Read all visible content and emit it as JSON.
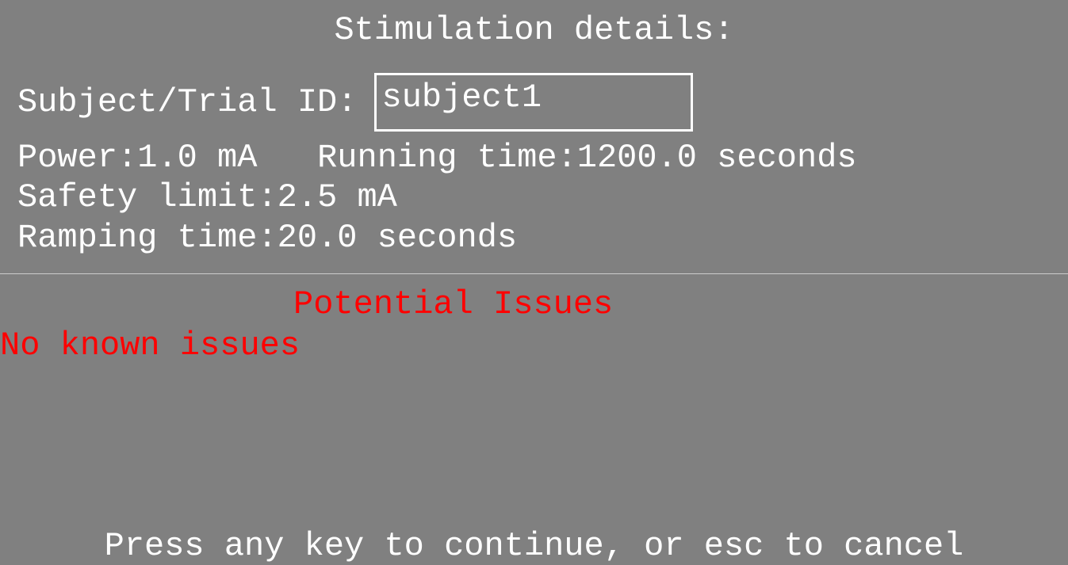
{
  "header": {
    "title": "Stimulation details:"
  },
  "subject": {
    "label": "Subject/Trial ID: ",
    "value": "subject1"
  },
  "params": {
    "power_label": "Power:",
    "power_value": "1.0 mA",
    "running_time_label": "Running time:",
    "running_time_value": "1200.0 seconds",
    "safety_limit_label": "Safety limit:",
    "safety_limit_value": "2.5 mA",
    "ramping_time_label": "Ramping time:",
    "ramping_time_value": "20.0 seconds"
  },
  "issues": {
    "title": "Potential Issues",
    "text": "No known issues"
  },
  "footer": {
    "prompt": "Press any key to continue, or esc to cancel"
  }
}
